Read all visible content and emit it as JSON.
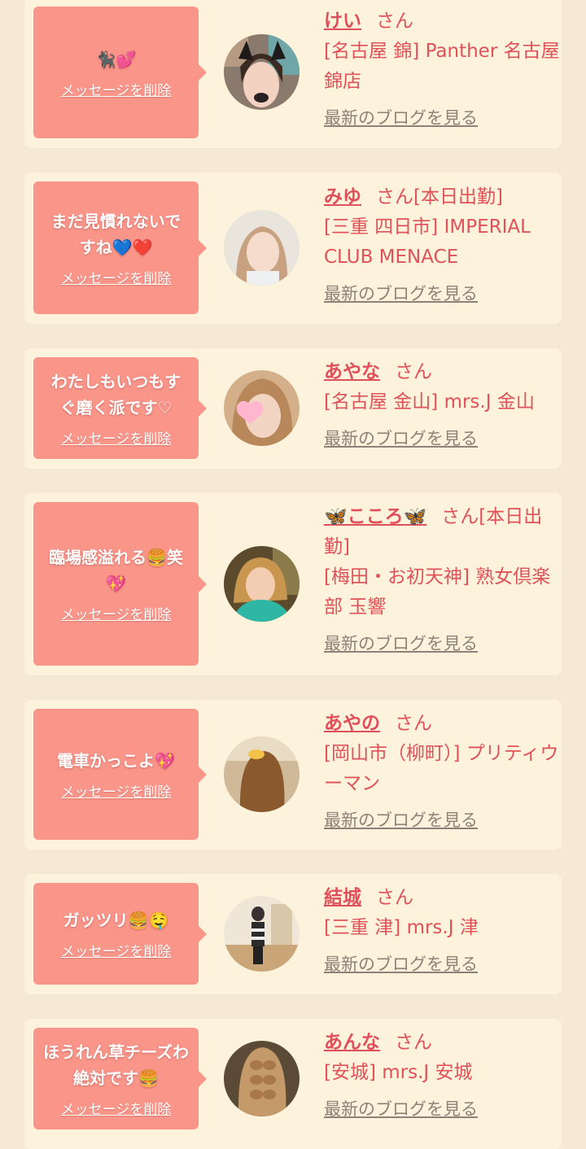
{
  "accent_color": "#fa958a",
  "name_color": "#e0505a",
  "cards": [
    {
      "message": "🐈‍⬛💕",
      "delete_label": "メッセージを削除",
      "name": "けい",
      "suffix": "さん",
      "shop": "[名古屋 錦] Panther 名古屋錦店",
      "blog_label": "最新のブログを見る"
    },
    {
      "message": "まだ見慣れないですね💙❤️",
      "delete_label": "メッセージを削除",
      "name": "みゆ",
      "suffix": "さん[本日出勤]",
      "shop": "[三重 四日市] IMPERIAL CLUB MENACE",
      "blog_label": "最新のブログを見る"
    },
    {
      "message": "わたしもいつもすぐ磨く派です♡",
      "delete_label": "メッセージを削除",
      "name": "あやな",
      "suffix": "さん",
      "shop": "[名古屋 金山] mrs.J 金山",
      "blog_label": "最新のブログを見る"
    },
    {
      "message": "臨場感溢れる🍔笑💖",
      "delete_label": "メッセージを削除",
      "name": "🦋こころ🦋",
      "suffix": "さん[本日出勤]",
      "shop": "[梅田・お初天神] 熟女倶楽部 玉響",
      "blog_label": "最新のブログを見る"
    },
    {
      "message": "電車かっこよ💖",
      "delete_label": "メッセージを削除",
      "name": "あやの",
      "suffix": "さん",
      "shop": "[岡山市（柳町）] プリティウーマン",
      "blog_label": "最新のブログを見る"
    },
    {
      "message": "ガッツリ🍔🤤",
      "delete_label": "メッセージを削除",
      "name": "結城",
      "suffix": "さん",
      "shop": "[三重 津] mrs.J 津",
      "blog_label": "最新のブログを見る"
    },
    {
      "message": "ほうれん草チーズわ絶対です🍔",
      "delete_label": "メッセージを削除",
      "name": "あんな",
      "suffix": "さん",
      "shop": "[安城] mrs.J 安城",
      "blog_label": "最新のブログを見る"
    }
  ]
}
